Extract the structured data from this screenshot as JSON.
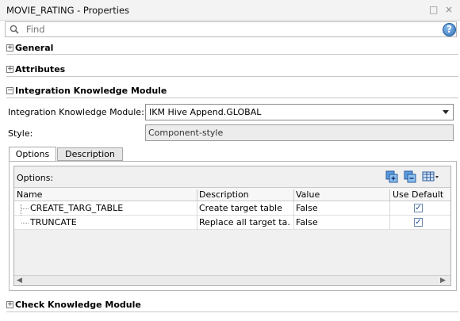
{
  "window": {
    "title": "MOVIE_RATING - Properties",
    "minimize_glyph": "□",
    "close_glyph": "×"
  },
  "search": {
    "placeholder": "Find"
  },
  "sections": {
    "general": "General",
    "attributes": "Attributes",
    "ikm": "Integration Knowledge Module",
    "ckm": "Check Knowledge Module"
  },
  "ikm": {
    "module_label": "Integration Knowledge Module:",
    "module_value": "IKM Hive Append.GLOBAL",
    "style_label": "Style:",
    "style_value": "Component-style"
  },
  "tabs": {
    "options": "Options",
    "description": "Description"
  },
  "options": {
    "title": "Options:",
    "columns": [
      "Name",
      "Description",
      "Value",
      "Use Default"
    ],
    "rows": [
      {
        "name": "CREATE_TARG_TABLE",
        "description": "Create target table",
        "value": "False",
        "use_default": true
      },
      {
        "name": "TRUNCATE",
        "description": "Replace all target ta...",
        "value": "False",
        "use_default": true
      }
    ]
  },
  "colors": {
    "accent": "#2f6fb8",
    "border": "#b0b0b0"
  },
  "icons": {
    "search": "search-icon",
    "help": "help-icon",
    "expand_all": "expand-all-icon",
    "collapse_all": "collapse-all-icon",
    "columns": "table-columns-icon"
  }
}
